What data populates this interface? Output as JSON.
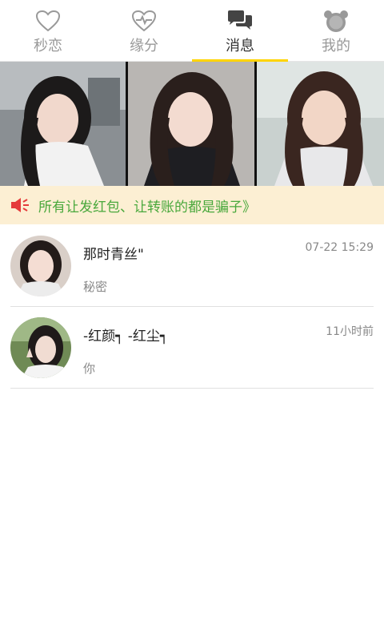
{
  "tabs": [
    {
      "label": "秒恋",
      "icon": "heart-outline-icon"
    },
    {
      "label": "缘分",
      "icon": "heart-pulse-icon"
    },
    {
      "label": "消息",
      "icon": "chat-bubbles-icon",
      "active": true
    },
    {
      "label": "我的",
      "icon": "bear-face-icon"
    }
  ],
  "accent_color": "#ffd400",
  "notice": {
    "text": "所有让发红包、让转账的都是骗子》",
    "icon": "megaphone-icon",
    "background": "#fcefd3",
    "text_color": "#49a83c"
  },
  "messages": [
    {
      "name": "那时青丝\"",
      "time": "07-22 15:29",
      "preview": "秘密"
    },
    {
      "name": "-红颜┑ -红尘┑",
      "time": "11小时前",
      "preview": "你"
    }
  ]
}
